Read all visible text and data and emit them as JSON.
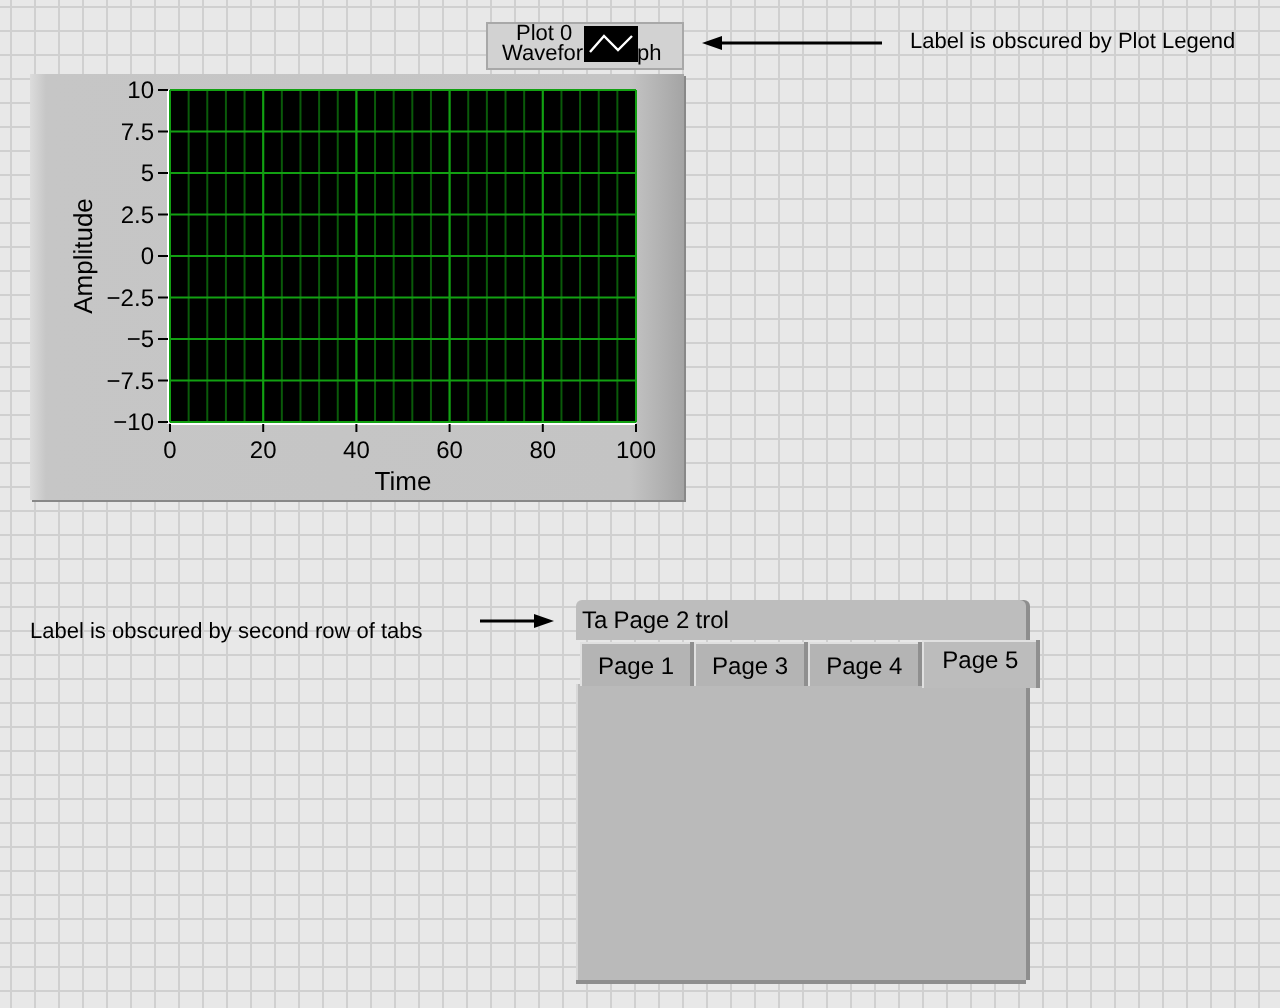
{
  "graph": {
    "label_parts": [
      "Wavefor",
      "ph"
    ],
    "legend": {
      "plot_name": "Plot 0"
    },
    "chart_data": {
      "type": "line",
      "grid": true,
      "xlabel": "Time",
      "ylabel": "Amplitude",
      "xlim": [
        0,
        100
      ],
      "ylim": [
        -10,
        10
      ],
      "xticks": [
        0,
        20,
        40,
        60,
        80,
        100
      ],
      "yticks": [
        {
          "value": 10,
          "label": "10"
        },
        {
          "value": 7.5,
          "label": "7.5"
        },
        {
          "value": 5,
          "label": "5"
        },
        {
          "value": 2.5,
          "label": "2.5"
        },
        {
          "value": 0,
          "label": "0"
        },
        {
          "value": -2.5,
          "label": "−2.5"
        },
        {
          "value": -5,
          "label": "−5"
        },
        {
          "value": -7.5,
          "label": "−7.5"
        },
        {
          "value": -10,
          "label": "−10"
        }
      ]
    }
  },
  "annotations": [
    {
      "text": "Label is obscured by Plot Legend",
      "kind": "arrow_left"
    },
    {
      "text": "Label is obscured by second row of tabs",
      "kind": "arrow_right"
    }
  ],
  "tab_control": {
    "label_parts": [
      "Ta",
      "trol"
    ],
    "back_row_tabs": [
      {
        "label": "Page 2",
        "selected": false
      }
    ],
    "front_row_tabs": [
      {
        "label": "Page 1",
        "selected": false
      },
      {
        "label": "Page 3",
        "selected": false
      },
      {
        "label": "Page 4",
        "selected": false
      },
      {
        "label": "Page 5",
        "selected": true
      }
    ]
  }
}
